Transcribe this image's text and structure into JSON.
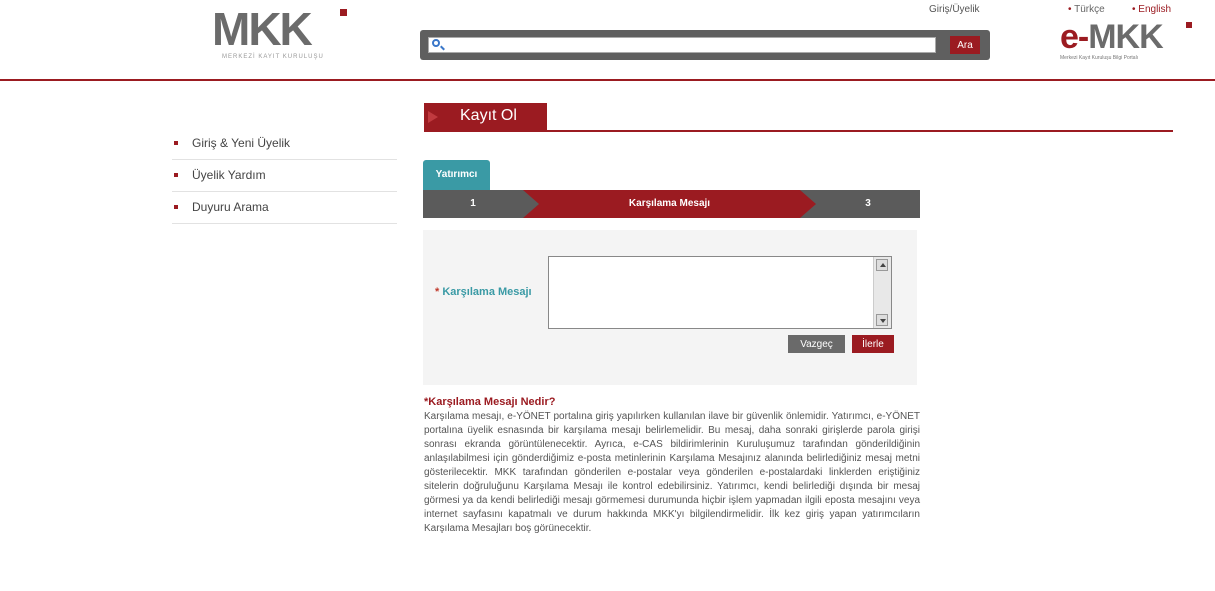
{
  "header": {
    "logo_text": "MKK",
    "logo_subtitle": "MERKEZİ KAYIT KURULUŞU",
    "login_link": "Giriş/Üyelik",
    "lang_tr": "Türkçe",
    "lang_en": "English",
    "emkk_e": "e-",
    "emkk_mkk": "MKK",
    "emkk_subtitle": "Merkezi Kayıt Kuruluşu Bilgi Portalı"
  },
  "search": {
    "placeholder": "",
    "button_label": "Ara"
  },
  "sidebar": {
    "items": [
      {
        "label": "Giriş & Yeni Üyelik"
      },
      {
        "label": "Üyelik Yardım"
      },
      {
        "label": "Duyuru Arama"
      }
    ]
  },
  "page": {
    "title": "Kayıt Ol"
  },
  "tabs": [
    {
      "label": "Yatırımcı"
    }
  ],
  "steps": [
    {
      "label": "1"
    },
    {
      "label": "Karşılama Mesajı"
    },
    {
      "label": "3"
    }
  ],
  "form": {
    "required_mark": "*",
    "field_label": "Karşılama Mesajı",
    "field_value": "",
    "cancel_label": "Vazgeç",
    "next_label": "İlerle"
  },
  "info": {
    "title": "*Karşılama Mesajı Nedir?",
    "body": "Karşılama mesajı, e-YÖNET portalına giriş yapılırken kullanılan ilave bir güvenlik önlemidir. Yatırımcı, e-YÖNET portalına üyelik esnasında bir karşılama mesajı belirlemelidir. Bu mesaj, daha sonraki girişlerde parola girişi sonrası ekranda görüntülenecektir. Ayrıca, e-CAS bildirimlerinin Kuruluşumuz tarafından gönderildiğinin anlaşılabilmesi için gönderdiğimiz e-posta metinlerinin Karşılama Mesajınız alanında belirlediğiniz mesaj metni gösterilecektir. MKK tarafından gönderilen e-postalar veya gönderilen e-postalardaki linklerden eriştiğiniz sitelerin doğruluğunu Karşılama Mesajı ile kontrol edebilirsiniz. Yatırımcı, kendi belirlediği dışında bir mesaj görmesi ya da kendi belirlediği mesajı görmemesi durumunda hiçbir işlem yapmadan ilgili eposta mesajını veya internet sayfasını kapatmalı ve durum hakkında MKK'yı bilgilendirmelidir. İlk kez giriş yapan yatırımcıların Karşılama Mesajları boş görünecektir."
  },
  "colors": {
    "brand": "#9b1b21",
    "accent": "#3a9aa5",
    "dark": "#5b5b5b"
  }
}
